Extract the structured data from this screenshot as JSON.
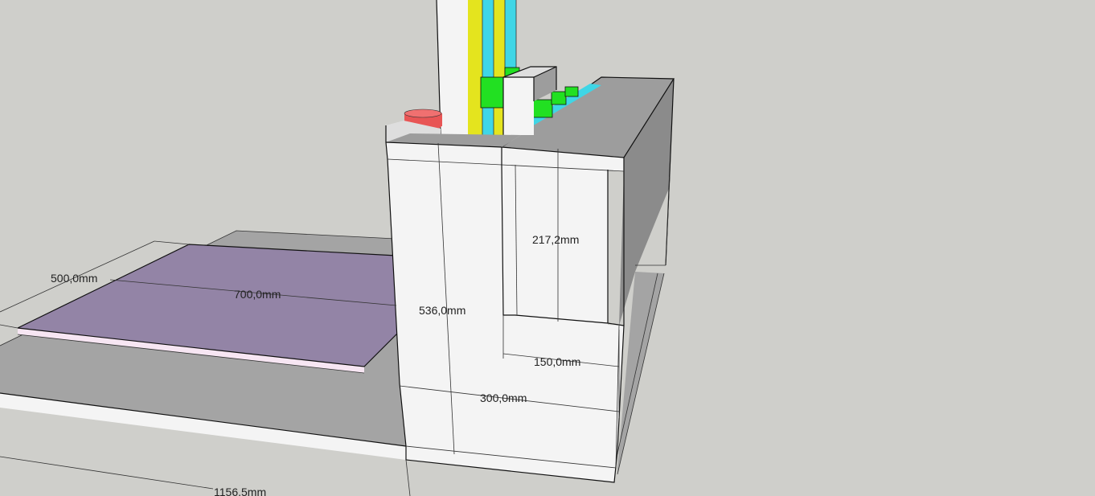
{
  "colors": {
    "background": "#cfcfcb",
    "ground": "#a4a4a4",
    "white_face": "#f4f4f4",
    "gray_face": "#9d9d9d",
    "pink_plate_top": "#9384a6",
    "pink_plate_edge": "#f7e6f3",
    "tube_yellow": "#e4e41e",
    "tube_cyan": "#3fd6e6",
    "connector_green": "#22e022",
    "red_cylinder": "#e85555"
  },
  "dimensions": {
    "plate_depth": "500,0mm",
    "plate_width": "700,0mm",
    "cabinet_height": "536,0mm",
    "panel_height": "217,2mm",
    "panel_offset": "150,0mm",
    "cabinet_width": "300,0mm",
    "base_length": "1156,5mm"
  }
}
